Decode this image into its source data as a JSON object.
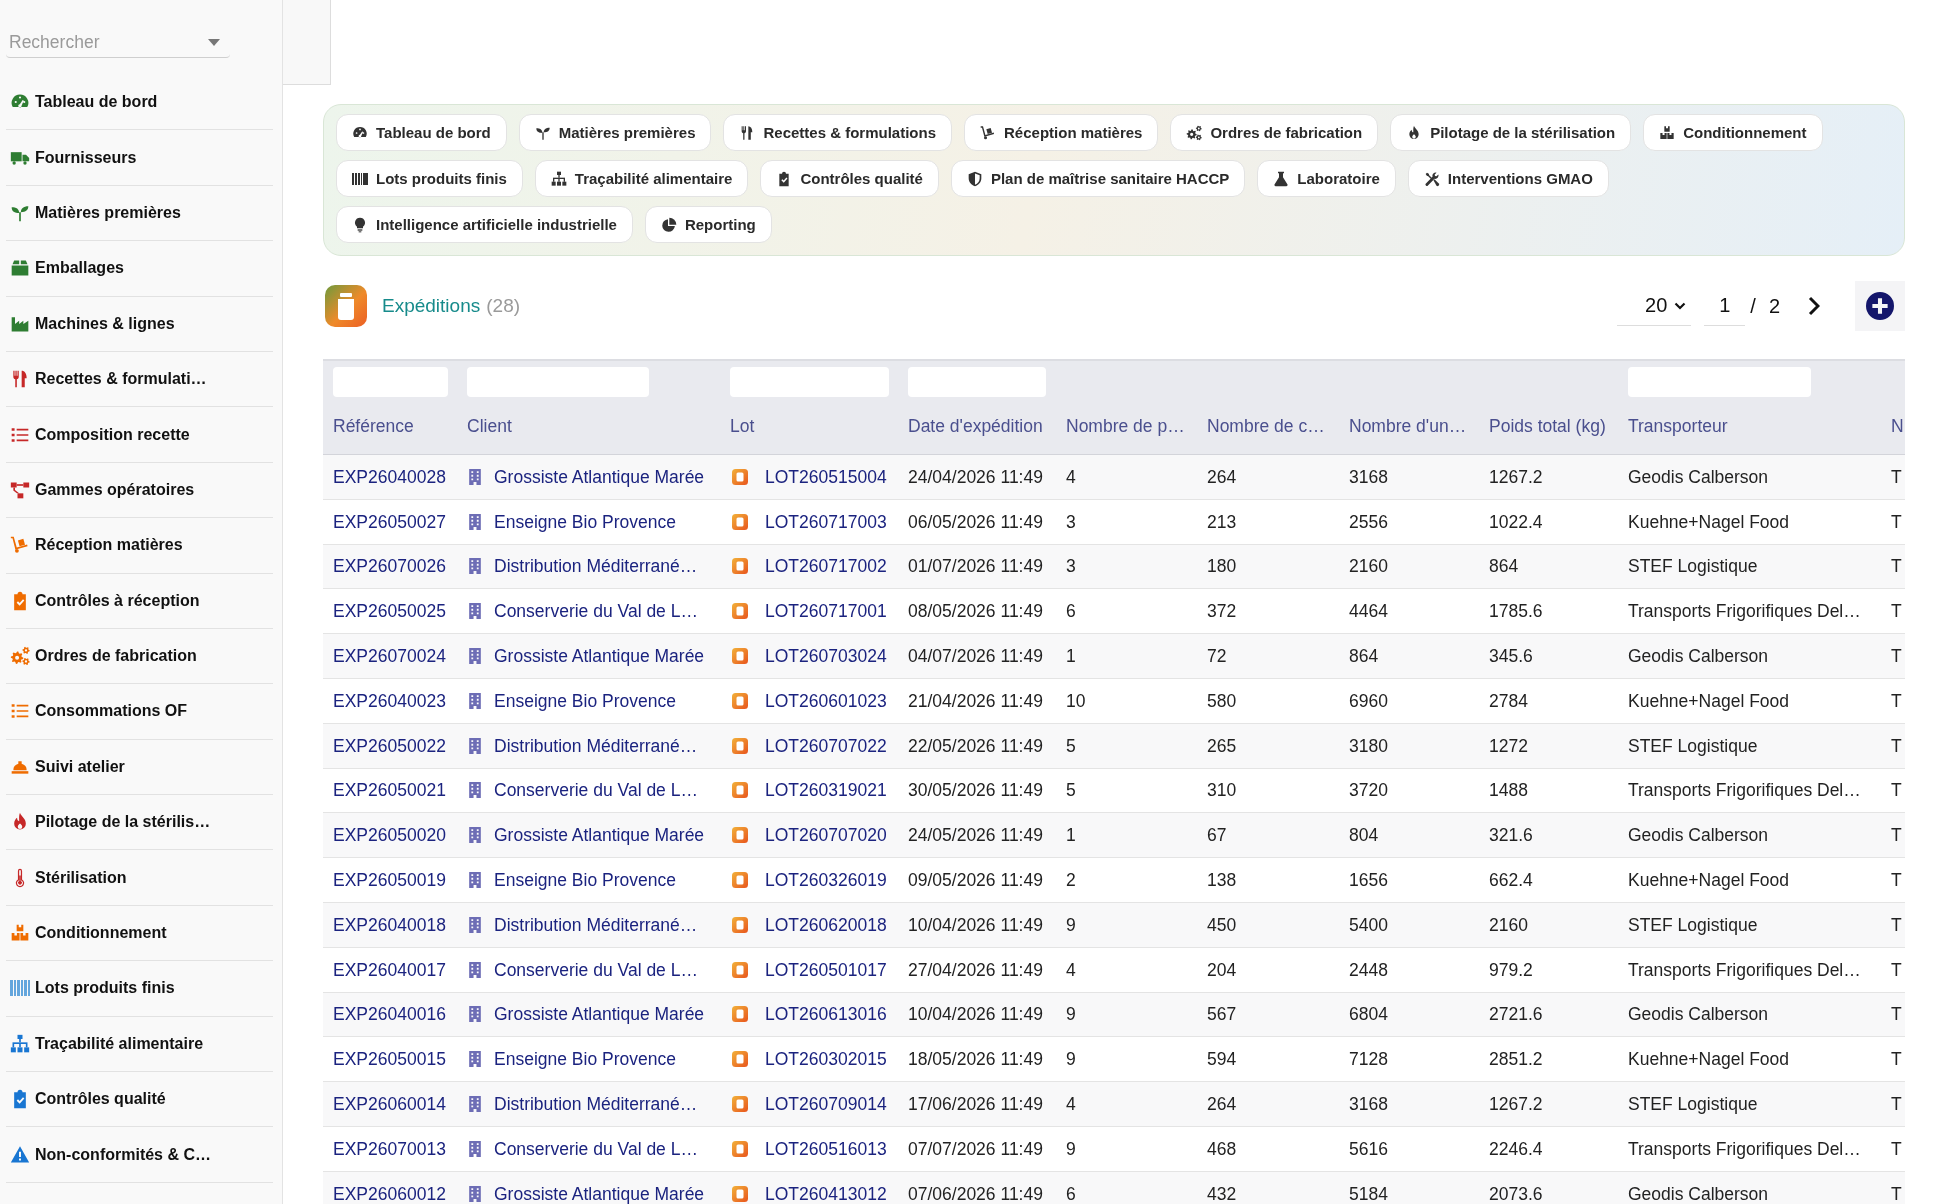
{
  "sidebar": {
    "search": {
      "placeholder": "Rechercher"
    },
    "items": [
      {
        "label": "Tableau de bord",
        "color": "#2e7d32"
      },
      {
        "label": "Fournisseurs",
        "color": "#2e7d32"
      },
      {
        "label": "Matières premières",
        "color": "#2e7d32"
      },
      {
        "label": "Emballages",
        "color": "#2e7d32"
      },
      {
        "label": "Machines & lignes",
        "color": "#2e7d32"
      },
      {
        "label": "Recettes & formulati…",
        "color": "#c62828"
      },
      {
        "label": "Composition recette",
        "color": "#c62828"
      },
      {
        "label": "Gammes opératoires",
        "color": "#c62828"
      },
      {
        "label": "Réception matières",
        "color": "#ef6c00"
      },
      {
        "label": "Contrôles à réception",
        "color": "#ef6c00"
      },
      {
        "label": "Ordres de fabrication",
        "color": "#ef6c00"
      },
      {
        "label": "Consommations OF",
        "color": "#ef6c00"
      },
      {
        "label": "Suivi atelier",
        "color": "#ef6c00"
      },
      {
        "label": "Pilotage de la stérilis…",
        "color": "#c62828"
      },
      {
        "label": "Stérilisation",
        "color": "#c62828"
      },
      {
        "label": "Conditionnement",
        "color": "#ef6c00"
      },
      {
        "label": "Lots produits finis",
        "color": "#64a6dd"
      },
      {
        "label": "Traçabilité alimentaire",
        "color": "#1976d2"
      },
      {
        "label": "Contrôles qualité",
        "color": "#1976d2"
      },
      {
        "label": "Non-conformités & C…",
        "color": "#1976d2"
      }
    ]
  },
  "shortcuts": [
    "Tableau de bord",
    "Matières premières",
    "Recettes & formulations",
    "Réception matières",
    "Ordres de fabrication",
    "Pilotage de la stérilisation",
    "Conditionnement",
    "Lots produits finis",
    "Traçabilité alimentaire",
    "Contrôles qualité",
    "Plan de maîtrise sanitaire HACCP",
    "Laboratoire",
    "Interventions GMAO",
    "Intelligence artificielle industrielle",
    "Reporting"
  ],
  "list": {
    "title": "Expéditions",
    "count": "(28)",
    "pagination": {
      "page_size": "20",
      "page": "1",
      "separator": "/",
      "page_count": "2"
    }
  },
  "table": {
    "columns": [
      {
        "label": "Référence",
        "kind": "link",
        "filter": true
      },
      {
        "label": "Client",
        "kind": "client",
        "filter": true
      },
      {
        "label": "Lot",
        "kind": "lot",
        "filter": true
      },
      {
        "label": "Date d'expédition",
        "kind": "text",
        "filter": true
      },
      {
        "label": "Nombre de p…",
        "kind": "text",
        "filter": false
      },
      {
        "label": "Nombre de c…",
        "kind": "text",
        "filter": false
      },
      {
        "label": "Nombre d'un…",
        "kind": "text",
        "filter": false
      },
      {
        "label": "Poids total (kg)",
        "kind": "text",
        "filter": false
      },
      {
        "label": "Transporteur",
        "kind": "text",
        "filter": true
      },
      {
        "label": "N",
        "kind": "text",
        "filter": false
      }
    ],
    "rows": [
      [
        "EXP26040028",
        "Grossiste Atlantique Marée",
        "LOT260515004",
        "24/04/2026 11:49",
        "4",
        "264",
        "3168",
        "1267.2",
        "Geodis Calberson",
        "T"
      ],
      [
        "EXP26050027",
        "Enseigne Bio Provence",
        "LOT260717003",
        "06/05/2026 11:49",
        "3",
        "213",
        "2556",
        "1022.4",
        "Kuehne+Nagel Food",
        "T"
      ],
      [
        "EXP26070026",
        "Distribution Méditerrané…",
        "LOT260717002",
        "01/07/2026 11:49",
        "3",
        "180",
        "2160",
        "864",
        "STEF Logistique",
        "T"
      ],
      [
        "EXP26050025",
        "Conserverie du Val de L…",
        "LOT260717001",
        "08/05/2026 11:49",
        "6",
        "372",
        "4464",
        "1785.6",
        "Transports Frigorifiques Del…",
        "T"
      ],
      [
        "EXP26070024",
        "Grossiste Atlantique Marée",
        "LOT260703024",
        "04/07/2026 11:49",
        "1",
        "72",
        "864",
        "345.6",
        "Geodis Calberson",
        "T"
      ],
      [
        "EXP26040023",
        "Enseigne Bio Provence",
        "LOT260601023",
        "21/04/2026 11:49",
        "10",
        "580",
        "6960",
        "2784",
        "Kuehne+Nagel Food",
        "T"
      ],
      [
        "EXP26050022",
        "Distribution Méditerrané…",
        "LOT260707022",
        "22/05/2026 11:49",
        "5",
        "265",
        "3180",
        "1272",
        "STEF Logistique",
        "T"
      ],
      [
        "EXP26050021",
        "Conserverie du Val de L…",
        "LOT260319021",
        "30/05/2026 11:49",
        "5",
        "310",
        "3720",
        "1488",
        "Transports Frigorifiques Del…",
        "T"
      ],
      [
        "EXP26050020",
        "Grossiste Atlantique Marée",
        "LOT260707020",
        "24/05/2026 11:49",
        "1",
        "67",
        "804",
        "321.6",
        "Geodis Calberson",
        "T"
      ],
      [
        "EXP26050019",
        "Enseigne Bio Provence",
        "LOT260326019",
        "09/05/2026 11:49",
        "2",
        "138",
        "1656",
        "662.4",
        "Kuehne+Nagel Food",
        "T"
      ],
      [
        "EXP26040018",
        "Distribution Méditerrané…",
        "LOT260620018",
        "10/04/2026 11:49",
        "9",
        "450",
        "5400",
        "2160",
        "STEF Logistique",
        "T"
      ],
      [
        "EXP26040017",
        "Conserverie du Val de L…",
        "LOT260501017",
        "27/04/2026 11:49",
        "4",
        "204",
        "2448",
        "979.2",
        "Transports Frigorifiques Del…",
        "T"
      ],
      [
        "EXP26040016",
        "Grossiste Atlantique Marée",
        "LOT260613016",
        "10/04/2026 11:49",
        "9",
        "567",
        "6804",
        "2721.6",
        "Geodis Calberson",
        "T"
      ],
      [
        "EXP26050015",
        "Enseigne Bio Provence",
        "LOT260302015",
        "18/05/2026 11:49",
        "9",
        "594",
        "7128",
        "2851.2",
        "Kuehne+Nagel Food",
        "T"
      ],
      [
        "EXP26060014",
        "Distribution Méditerrané…",
        "LOT260709014",
        "17/06/2026 11:49",
        "4",
        "264",
        "3168",
        "1267.2",
        "STEF Logistique",
        "T"
      ],
      [
        "EXP26070013",
        "Conserverie du Val de L…",
        "LOT260516013",
        "07/07/2026 11:49",
        "9",
        "468",
        "5616",
        "2246.4",
        "Transports Frigorifiques Del…",
        "T"
      ],
      [
        "EXP26060012",
        "Grossiste Atlantique Marée",
        "LOT260413012",
        "07/06/2026 11:49",
        "6",
        "432",
        "5184",
        "2073.6",
        "Geodis Calberson",
        "T"
      ]
    ]
  }
}
